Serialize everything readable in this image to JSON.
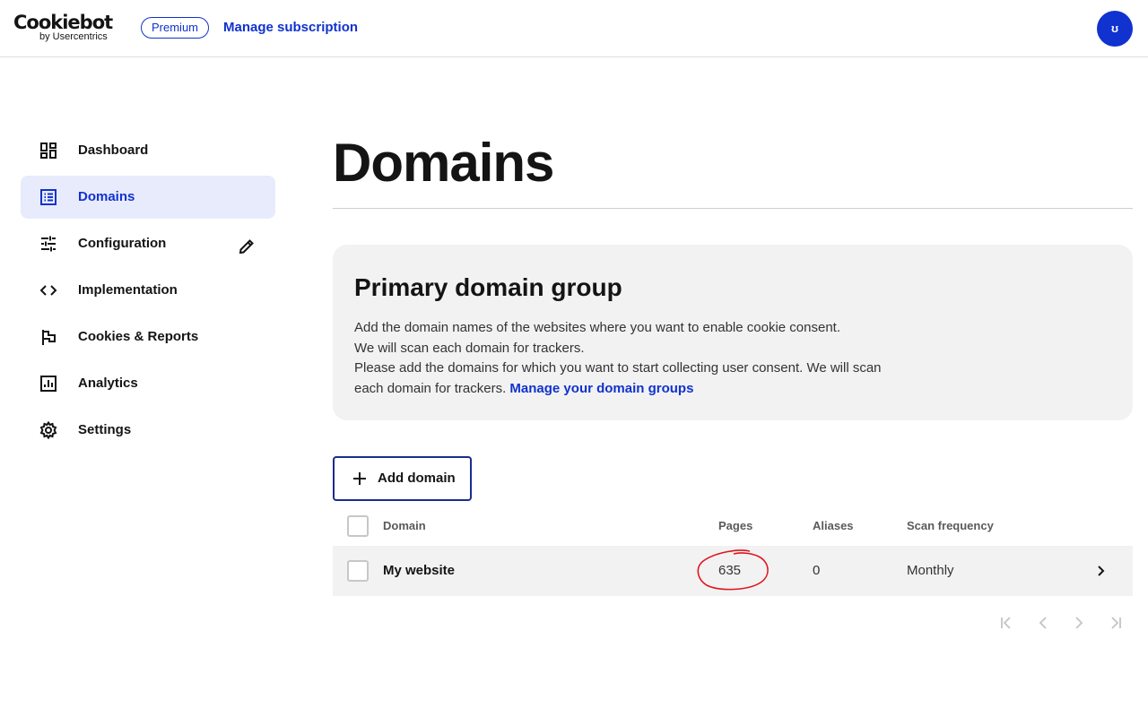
{
  "header": {
    "logo_main": "Cookiebot",
    "logo_sub": "by Usercentrics",
    "plan_badge": "Premium",
    "manage_subscription": "Manage subscription",
    "avatar_initial": "ʊ"
  },
  "sidebar": {
    "items": [
      {
        "label": "Dashboard",
        "icon": "dashboard-icon",
        "active": false
      },
      {
        "label": "Domains",
        "icon": "list-icon",
        "active": true
      },
      {
        "label": "Configuration",
        "icon": "sliders-icon",
        "active": false
      },
      {
        "label": "Implementation",
        "icon": "code-icon",
        "active": false
      },
      {
        "label": "Cookies & Reports",
        "icon": "flag-icon",
        "active": false
      },
      {
        "label": "Analytics",
        "icon": "chart-icon",
        "active": false
      },
      {
        "label": "Settings",
        "icon": "gear-icon",
        "active": false
      }
    ]
  },
  "main": {
    "title": "Domains",
    "group": {
      "title": "Primary domain group",
      "line1": "Add the domain names of the websites where you want to enable cookie consent.",
      "line2": "We will scan each domain for trackers.",
      "line3": "Please add the domains for which you want to start collecting user consent. We will scan each domain for trackers.",
      "link": "Manage your domain groups"
    },
    "add_button": "Add domain",
    "table": {
      "headers": {
        "domain": "Domain",
        "pages": "Pages",
        "aliases": "Aliases",
        "scan": "Scan frequency"
      },
      "rows": [
        {
          "domain": "My website",
          "pages": "635",
          "aliases": "0",
          "scan": "Monthly"
        }
      ]
    }
  },
  "colors": {
    "brand": "#1032cf",
    "active_nav_bg": "#e8ebfc",
    "card_bg": "#f2f2f2",
    "annotation": "#e0141e"
  }
}
